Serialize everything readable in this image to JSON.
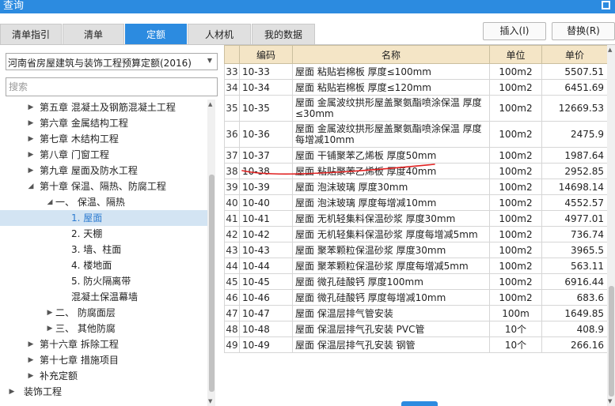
{
  "window": {
    "title": "查询"
  },
  "tabs": [
    {
      "label": "清单指引",
      "active": false
    },
    {
      "label": "清单",
      "active": false
    },
    {
      "label": "定额",
      "active": true
    },
    {
      "label": "人材机",
      "active": false
    },
    {
      "label": "我的数据",
      "active": false
    }
  ],
  "buttons": {
    "insert": "插入(I)",
    "replace": "替换(R)"
  },
  "library_select": {
    "value": "河南省房屋建筑与装饰工程预算定额(2016)"
  },
  "search": {
    "placeholder": "搜索"
  },
  "tree": [
    {
      "label": "第五章 混凝土及钢筋混凝土工程",
      "level": 1,
      "caret": "▶",
      "selected": false
    },
    {
      "label": "第六章 金属结构工程",
      "level": 1,
      "caret": "▶",
      "selected": false
    },
    {
      "label": "第七章 木结构工程",
      "level": 1,
      "caret": "▶",
      "selected": false
    },
    {
      "label": "第八章 门窗工程",
      "level": 1,
      "caret": "▶",
      "selected": false
    },
    {
      "label": "第九章 屋面及防水工程",
      "level": 1,
      "caret": "▶",
      "selected": false
    },
    {
      "label": "第十章 保温、隔热、防腐工程",
      "level": 1,
      "caret": "◢",
      "selected": false
    },
    {
      "label": "一、 保温、隔热",
      "level": 2,
      "caret": "◢",
      "selected": false
    },
    {
      "label": "1. 屋面",
      "level": 3,
      "caret": "",
      "selected": true
    },
    {
      "label": "2. 天棚",
      "level": 3,
      "caret": "",
      "selected": false
    },
    {
      "label": "3. 墙、柱面",
      "level": 3,
      "caret": "",
      "selected": false
    },
    {
      "label": "4. 楼地面",
      "level": 3,
      "caret": "",
      "selected": false
    },
    {
      "label": "5. 防火隔离带",
      "level": 3,
      "caret": "",
      "selected": false
    },
    {
      "label": "混凝土保温幕墙",
      "level": 3,
      "caret": "",
      "selected": false
    },
    {
      "label": "二、 防腐面层",
      "level": 2,
      "caret": "▶",
      "selected": false
    },
    {
      "label": "三、 其他防腐",
      "level": 2,
      "caret": "▶",
      "selected": false
    },
    {
      "label": "第十六章 拆除工程",
      "level": 1,
      "caret": "▶",
      "selected": false
    },
    {
      "label": "第十七章 措施项目",
      "level": 1,
      "caret": "▶",
      "selected": false
    },
    {
      "label": "补充定额",
      "level": 1,
      "caret": "▶",
      "selected": false
    },
    {
      "label": "装饰工程",
      "level": 0,
      "caret": "▶",
      "selected": false
    }
  ],
  "table": {
    "headers": [
      "编码",
      "名称",
      "单位",
      "单价"
    ],
    "rows": [
      {
        "rn": "33",
        "code": "10-33",
        "name": "屋面 粘贴岩棉板 厚度≤100mm",
        "unit": "100m2",
        "price": "5507.51",
        "tall": false
      },
      {
        "rn": "34",
        "code": "10-34",
        "name": "屋面 粘贴岩棉板 厚度≤120mm",
        "unit": "100m2",
        "price": "6451.69",
        "tall": false
      },
      {
        "rn": "35",
        "code": "10-35",
        "name": "屋面 金属波纹拱形屋盖聚氨酯喷涂保温 厚度≤30mm",
        "unit": "100m2",
        "price": "12669.53",
        "tall": true
      },
      {
        "rn": "36",
        "code": "10-36",
        "name": "屋面 金属波纹拱形屋盖聚氨酯喷涂保温 厚度每增减10mm",
        "unit": "100m2",
        "price": "2475.9",
        "tall": true
      },
      {
        "rn": "37",
        "code": "10-37",
        "name": "屋面 干铺聚苯乙烯板 厚度50mm",
        "unit": "100m2",
        "price": "1987.64",
        "tall": false
      },
      {
        "rn": "38",
        "code": "10-38",
        "name": "屋面 粘贴聚苯乙烯板 厚度40mm",
        "unit": "100m2",
        "price": "2952.85",
        "tall": false
      },
      {
        "rn": "39",
        "code": "10-39",
        "name": "屋面 泡沫玻璃 厚度30mm",
        "unit": "100m2",
        "price": "14698.14",
        "tall": false
      },
      {
        "rn": "40",
        "code": "10-40",
        "name": "屋面 泡沫玻璃 厚度每增减10mm",
        "unit": "100m2",
        "price": "4552.57",
        "tall": false
      },
      {
        "rn": "41",
        "code": "10-41",
        "name": "屋面 无机轻集料保温砂浆 厚度30mm",
        "unit": "100m2",
        "price": "4977.01",
        "tall": false
      },
      {
        "rn": "42",
        "code": "10-42",
        "name": "屋面 无机轻集料保温砂浆 厚度每增减5mm",
        "unit": "100m2",
        "price": "736.74",
        "tall": false
      },
      {
        "rn": "43",
        "code": "10-43",
        "name": "屋面 聚苯颗粒保温砂浆 厚度30mm",
        "unit": "100m2",
        "price": "3965.5",
        "tall": false
      },
      {
        "rn": "44",
        "code": "10-44",
        "name": "屋面 聚苯颗粒保温砂浆 厚度每增减5mm",
        "unit": "100m2",
        "price": "563.11",
        "tall": false
      },
      {
        "rn": "45",
        "code": "10-45",
        "name": "屋面 微孔硅酸钙 厚度100mm",
        "unit": "100m2",
        "price": "6916.44",
        "tall": false
      },
      {
        "rn": "46",
        "code": "10-46",
        "name": "屋面 微孔硅酸钙 厚度每增减10mm",
        "unit": "100m2",
        "price": "683.6",
        "tall": false
      },
      {
        "rn": "47",
        "code": "10-47",
        "name": "屋面 保温层排气管安装",
        "unit": "100m",
        "price": "1649.85",
        "tall": false
      },
      {
        "rn": "48",
        "code": "10-48",
        "name": "屋面 保温层排气孔安装 PVC管",
        "unit": "10个",
        "price": "408.9",
        "tall": false
      },
      {
        "rn": "49",
        "code": "10-49",
        "name": "屋面 保温层排气孔安装 钢管",
        "unit": "10个",
        "price": "266.16",
        "tall": false
      }
    ]
  },
  "colors": {
    "accent": "#2c8be0",
    "header_bg": "#f4e5c6",
    "selected_bg": "#d3e4f3",
    "annotation": "#e02020"
  }
}
